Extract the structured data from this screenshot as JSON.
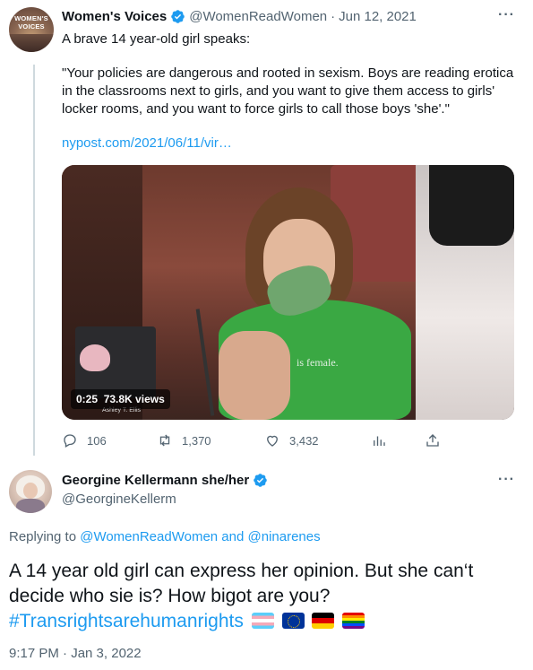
{
  "tweet1": {
    "author_name": "Women's Voices",
    "handle": "@WomenReadWomen",
    "separator": "·",
    "date": "Jun 12, 2021",
    "avatar_text": "WOMEN'S VOICES",
    "intro": "A brave 14 year-old girl speaks:",
    "quote": "\"Your policies are dangerous and rooted in sexism. Boys are reading erotica in the classrooms next to girls, and you want to give them access to girls' locker rooms, and you want to force girls to call those boys 'she'.\"",
    "link": "nypost.com/2021/06/11/vir…",
    "video": {
      "duration": "0:25",
      "views": "73.8K views",
      "shirt_text": "is female.",
      "sign_text": "Ashley T. Ellis"
    },
    "actions": {
      "replies": "106",
      "retweets": "1,370",
      "likes": "3,432"
    }
  },
  "tweet2": {
    "author_name": "Georgine Kellermann she/her",
    "handle": "@GeorgineKellerm",
    "replying_prefix": "Replying to",
    "replying_mention_1": "@WomenReadWomen",
    "replying_and": "and",
    "replying_mention_2": "@ninarenes",
    "text": "A 14 year old girl can express her opinion. But she can‘t decide who sie is? How bigot are you?",
    "hashtag": "#Transrightsarehumanrights",
    "flags": [
      "transgender-flag",
      "eu-flag",
      "germany-flag",
      "rainbow-flag"
    ],
    "timestamp": "9:17 PM · Jan 3, 2022"
  },
  "more_label": "···",
  "colors": {
    "accent": "#1d9bf0",
    "text": "#0f1419",
    "secondary": "#536471",
    "thread_line": "#cfd9de"
  }
}
